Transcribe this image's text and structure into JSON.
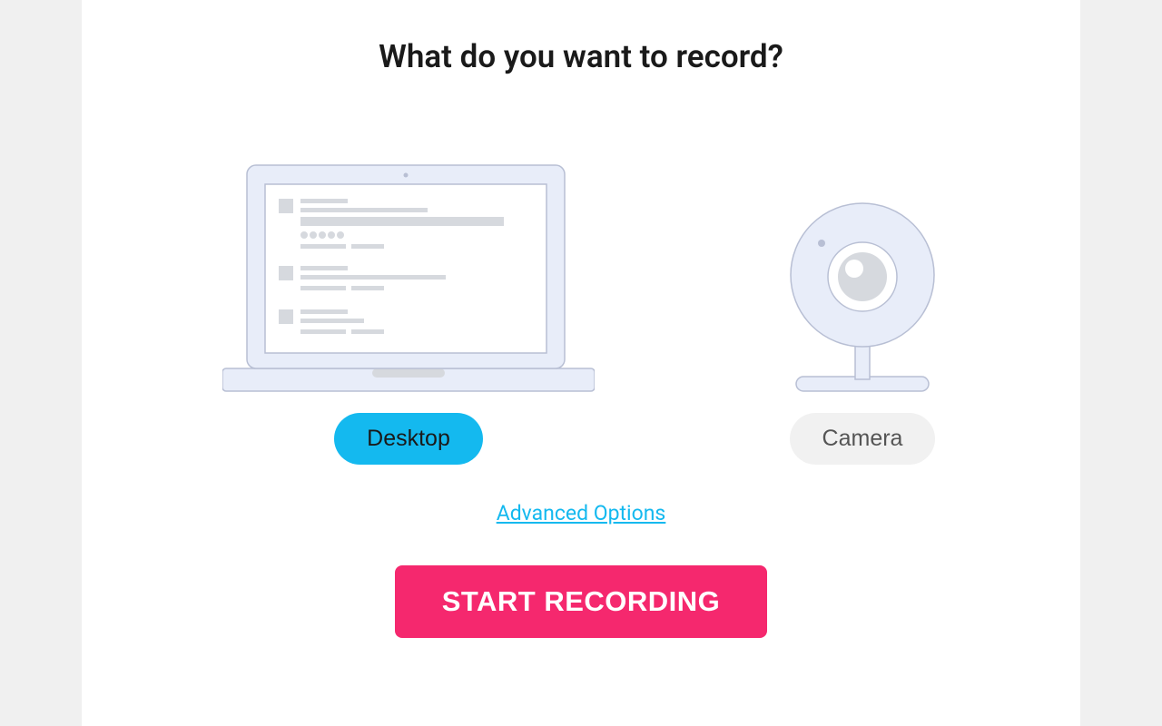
{
  "title": "What do you want to record?",
  "options": {
    "desktop": {
      "label": "Desktop",
      "selected": true
    },
    "camera": {
      "label": "Camera",
      "selected": false
    }
  },
  "advanced_link": "Advanced Options",
  "start_button": "START RECORDING",
  "colors": {
    "accent": "#14b9ef",
    "primary_action": "#f5286e",
    "icon_fill": "#e8edf9",
    "icon_stroke": "#b8bfd4",
    "placeholder": "#d6d9de"
  }
}
